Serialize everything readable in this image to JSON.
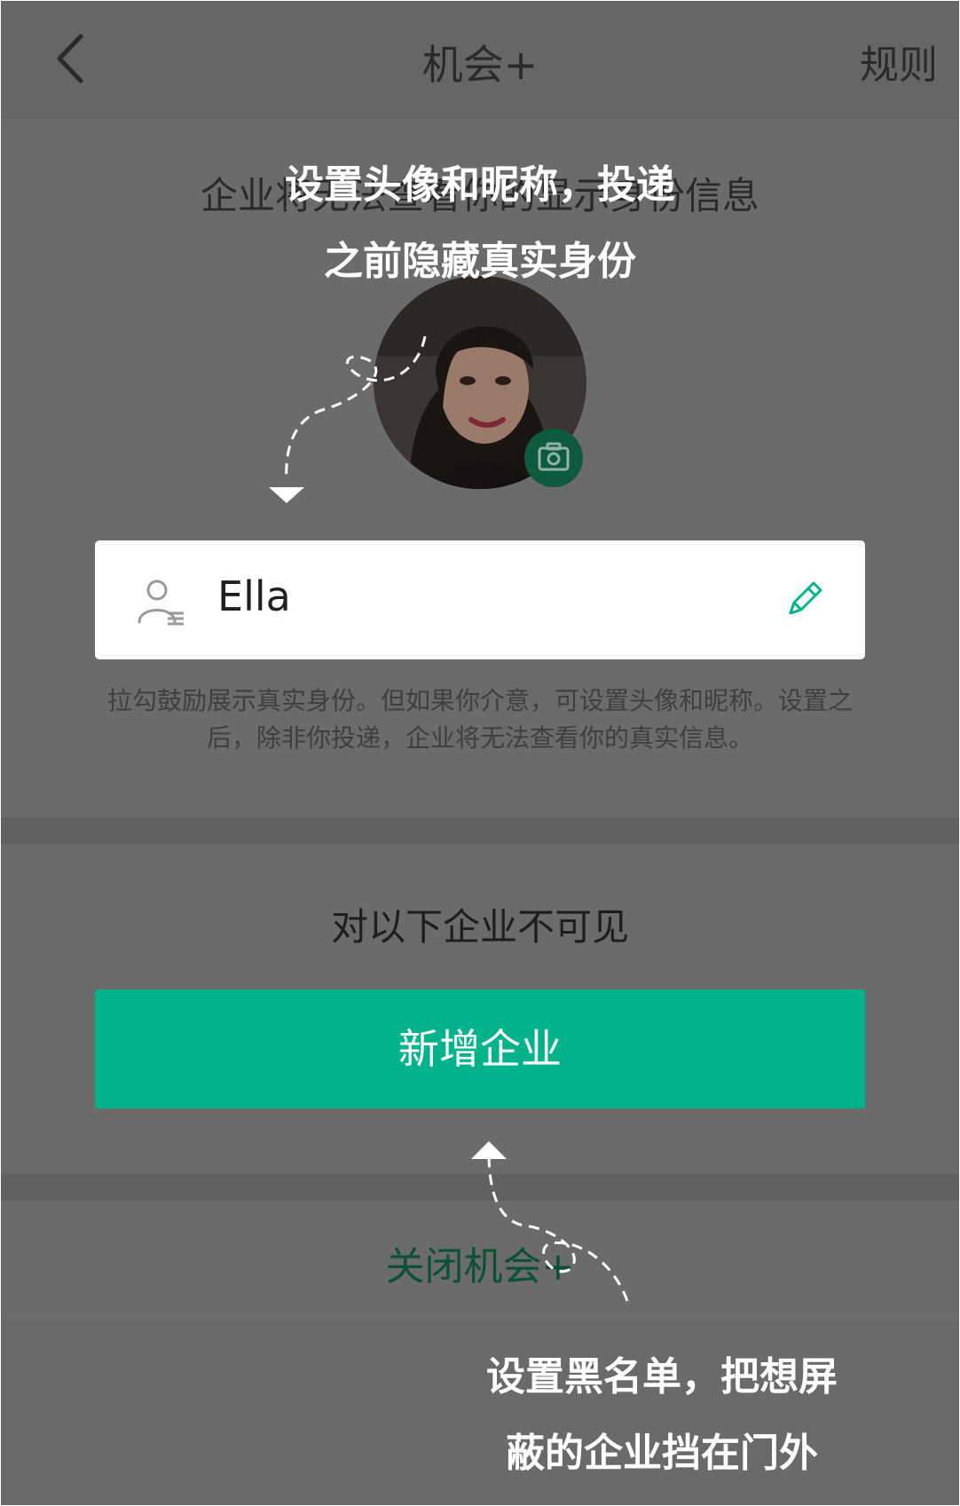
{
  "navbar": {
    "back_icon": "chevron-left-icon",
    "title": "机会+",
    "rules_label": "规则"
  },
  "header": {
    "description": "企业将无法查看你的显示身份信息"
  },
  "guide": {
    "top_line1": "设置头像和昵称，投递",
    "top_line2": "之前隐藏真实身份",
    "bottom_line1": "设置黑名单，把想屏",
    "bottom_line2": "蔽的企业挡在门外"
  },
  "profile": {
    "camera_icon": "camera-icon",
    "nickname": "Ella",
    "user_icon": "user-card-icon",
    "edit_icon": "pencil-icon"
  },
  "hint": {
    "text": "拉勾鼓励展示真实身份。但如果你介意，可设置头像和昵称。设置之后，除非你投递，企业将无法查看你的真实信息。"
  },
  "blocklist": {
    "title": "对以下企业不可见",
    "add_button": "新增企业"
  },
  "footer": {
    "close_label": "关闭机会+"
  },
  "colors": {
    "accent": "#00b38a",
    "overlay_bg": "#6b6b6b"
  }
}
